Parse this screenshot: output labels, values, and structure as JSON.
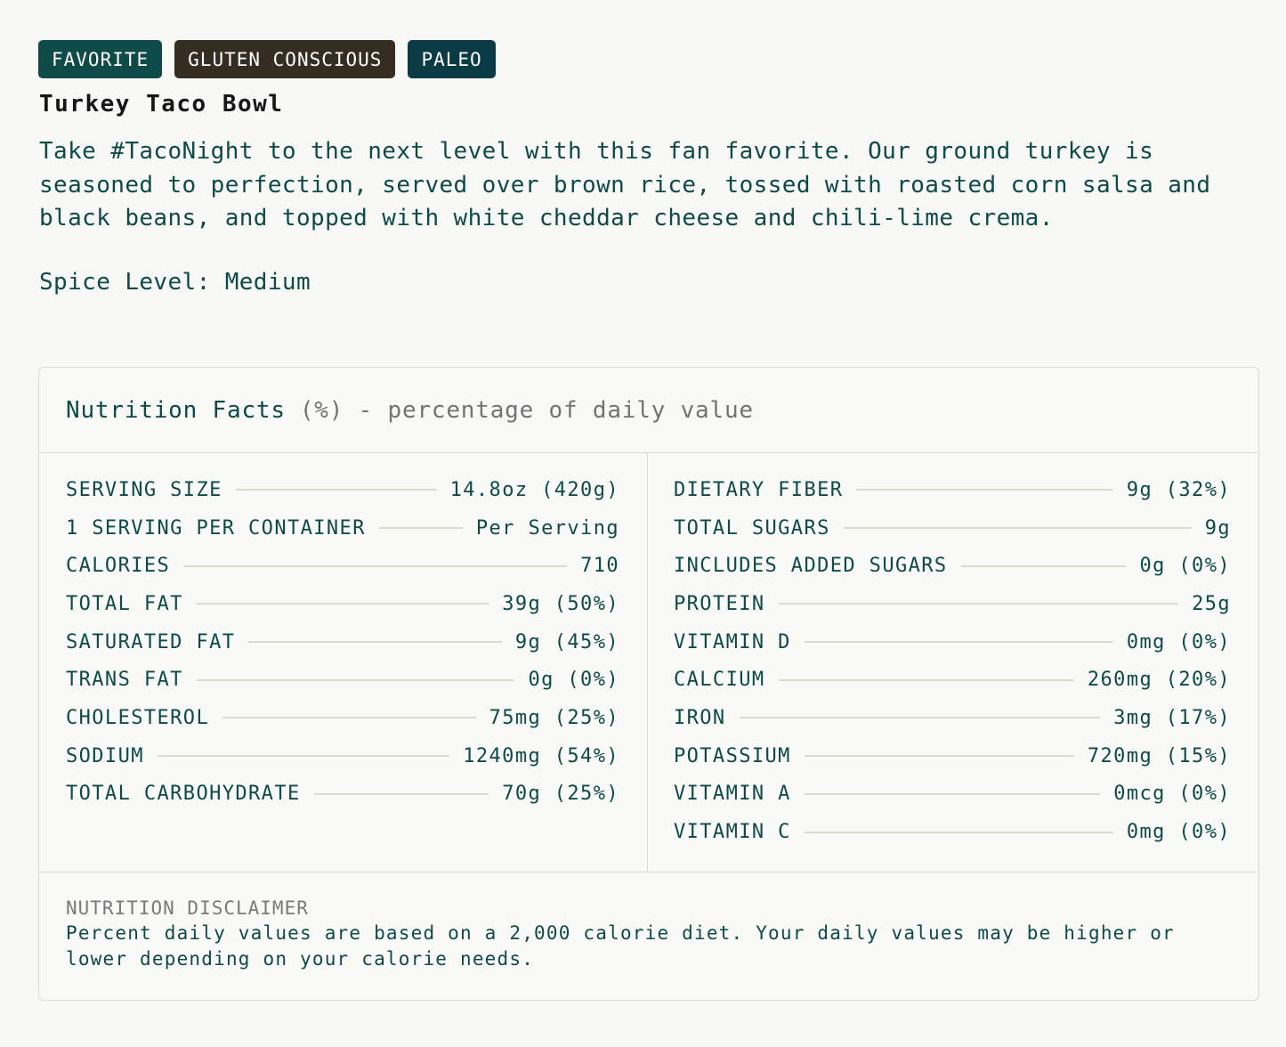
{
  "tags": [
    {
      "label": "FAVORITE",
      "color": "#0d4a48"
    },
    {
      "label": "GLUTEN CONSCIOUS",
      "color": "#362d22"
    },
    {
      "label": "PALEO",
      "color": "#0a3a43"
    }
  ],
  "product": {
    "title": "Turkey Taco Bowl",
    "description": "Take #TacoNight to the next level with this fan favorite. Our ground turkey is seasoned to perfection, served over brown rice, tossed with roasted corn salsa and black beans, and topped with white cheddar cheese and chili-lime crema.",
    "spice_level": "Spice Level: Medium"
  },
  "nutrition": {
    "heading": "Nutrition Facts",
    "heading_note": "(%) - percentage of daily value",
    "left": [
      {
        "name": "SERVING SIZE",
        "value": "14.8oz (420g)"
      },
      {
        "name": "1 SERVING PER CONTAINER",
        "value": "Per Serving"
      },
      {
        "name": "CALORIES",
        "value": "710"
      },
      {
        "name": "TOTAL FAT",
        "value": "39g (50%)"
      },
      {
        "name": "SATURATED FAT",
        "value": "9g (45%)"
      },
      {
        "name": "TRANS FAT",
        "value": "0g (0%)"
      },
      {
        "name": "CHOLESTEROL",
        "value": "75mg (25%)"
      },
      {
        "name": "SODIUM",
        "value": "1240mg (54%)"
      },
      {
        "name": "TOTAL CARBOHYDRATE",
        "value": "70g (25%)"
      }
    ],
    "right": [
      {
        "name": "DIETARY FIBER",
        "value": "9g (32%)"
      },
      {
        "name": "TOTAL SUGARS",
        "value": "9g"
      },
      {
        "name": "INCLUDES ADDED SUGARS",
        "value": "0g (0%)"
      },
      {
        "name": "PROTEIN",
        "value": "25g"
      },
      {
        "name": "VITAMIN D",
        "value": "0mg (0%)"
      },
      {
        "name": "CALCIUM",
        "value": "260mg (20%)"
      },
      {
        "name": "IRON",
        "value": "3mg (17%)"
      },
      {
        "name": "POTASSIUM",
        "value": "720mg (15%)"
      },
      {
        "name": "VITAMIN A",
        "value": "0mcg (0%)"
      },
      {
        "name": "VITAMIN C",
        "value": "0mg (0%)"
      }
    ],
    "disclaimer_title": "NUTRITION DISCLAIMER",
    "disclaimer_text": "Percent daily values are based on a 2,000 calorie diet. Your daily values may be higher or lower depending on your calorie needs."
  }
}
